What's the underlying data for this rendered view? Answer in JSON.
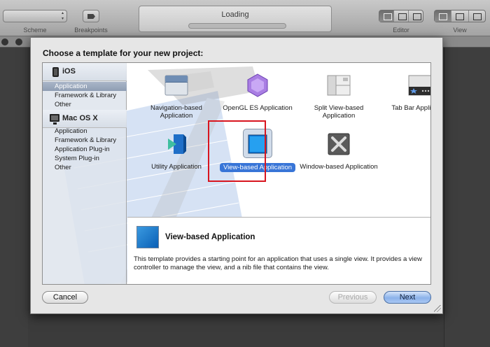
{
  "toolbar": {
    "scheme_label": "Scheme",
    "breakpoints_label": "Breakpoints",
    "activity_text": "Loading",
    "editor_label": "Editor",
    "view_label": "View"
  },
  "dialog": {
    "title": "Choose a template for your new project:",
    "sidebar": {
      "groups": [
        {
          "header": "iOS",
          "icon": "iphone-icon",
          "items": [
            "Application",
            "Framework & Library",
            "Other"
          ],
          "selected": 0
        },
        {
          "header": "Mac OS X",
          "icon": "mac-icon",
          "items": [
            "Application",
            "Framework & Library",
            "Application Plug-in",
            "System Plug-in",
            "Other"
          ]
        }
      ]
    },
    "templates": [
      {
        "name": "Navigation-based Application",
        "icon": "navigation-app-icon"
      },
      {
        "name": "OpenGL ES Application",
        "icon": "opengl-es-icon"
      },
      {
        "name": "Split View-based Application",
        "icon": "split-view-icon"
      },
      {
        "name": "Tab Bar Application",
        "icon": "tab-bar-icon"
      },
      {
        "name": "Utility Application",
        "icon": "utility-app-icon"
      },
      {
        "name": "View-based Application",
        "icon": "view-based-icon",
        "selected": true
      },
      {
        "name": "Window-based Application",
        "icon": "window-based-icon"
      }
    ],
    "detail": {
      "title": "View-based Application",
      "description": "This template provides a starting point for an application that uses a single view. It provides a view controller to manage the view, and a nib file that contains the view."
    },
    "buttons": {
      "cancel": "Cancel",
      "previous": "Previous",
      "next": "Next"
    },
    "colors": {
      "selection": "#3875d7",
      "highlight_border": "#d8151f"
    }
  }
}
